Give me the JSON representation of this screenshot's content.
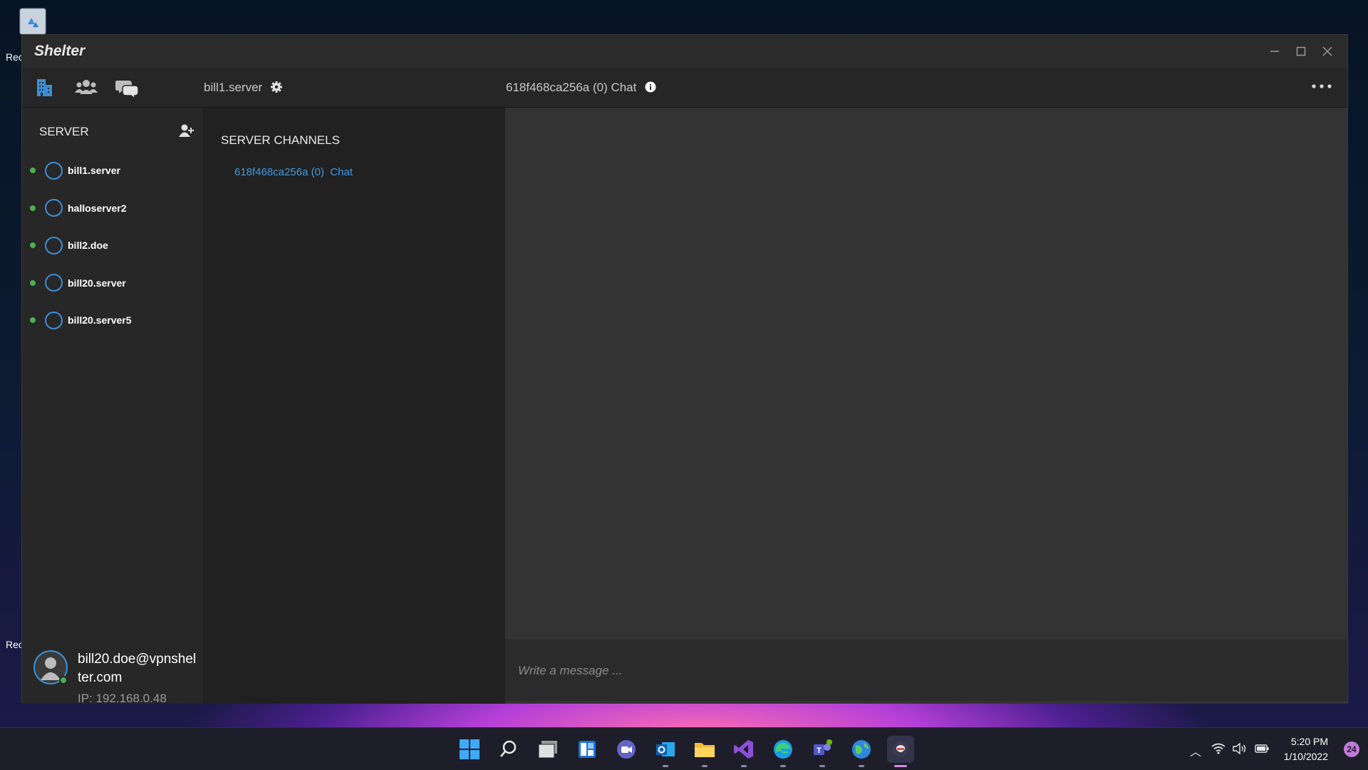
{
  "desktop": {
    "recycle_label_top": "Rec",
    "recycle_label_bottom": "Rec"
  },
  "window": {
    "title": "Shelter"
  },
  "toolbar": {
    "server_name": "bill1.server",
    "channel_title": "618f468ca256a (0) Chat"
  },
  "sidebar": {
    "header": "SERVER",
    "servers": [
      {
        "label": "bill1.server"
      },
      {
        "label": "halloserver2"
      },
      {
        "label": "bill2.doe"
      },
      {
        "label": "bill20.server"
      },
      {
        "label": "bill20.server5"
      }
    ],
    "profile": {
      "email": "bill20.doe@vpnshelter.com",
      "ip": "IP: 192.168.0.48"
    }
  },
  "channels": {
    "header": "SERVER CHANNELS",
    "items": [
      {
        "label": "618f468ca256a (0)  Chat"
      }
    ]
  },
  "chat": {
    "composer_placeholder": "Write a message ..."
  },
  "taskbar": {
    "time": "5:20 PM",
    "date": "1/10/2022",
    "notifications": "24"
  },
  "colors": {
    "accent_blue": "#3f9ae2",
    "online_green": "#4caf50",
    "chat_bg": "#333333",
    "sidebar_bg": "#272727"
  }
}
